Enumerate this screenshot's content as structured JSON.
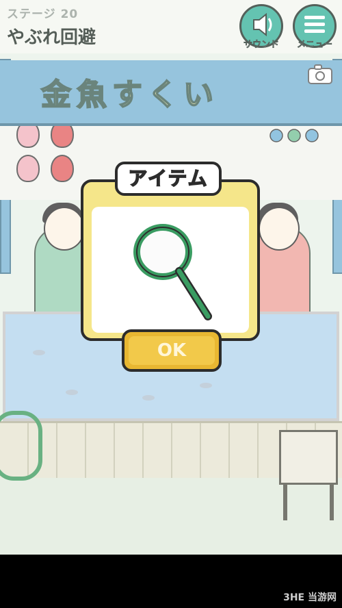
{
  "header": {
    "stage_label": "ステージ 20",
    "stage_title": "やぶれ回避"
  },
  "buttons": {
    "sound_label": "サウンド",
    "menu_label": "メニュー"
  },
  "stall": {
    "banner_text": "金魚すくい"
  },
  "dialog": {
    "title": "アイテム",
    "item_icon": "scoop-net-icon",
    "ok_label": "OK"
  },
  "watermark": "3HE 当游网",
  "colors": {
    "accent_teal": "#43b6a0",
    "dialog_yellow": "#f5e68a",
    "ok_button": "#e8b732",
    "net_green": "#3a9c62"
  }
}
